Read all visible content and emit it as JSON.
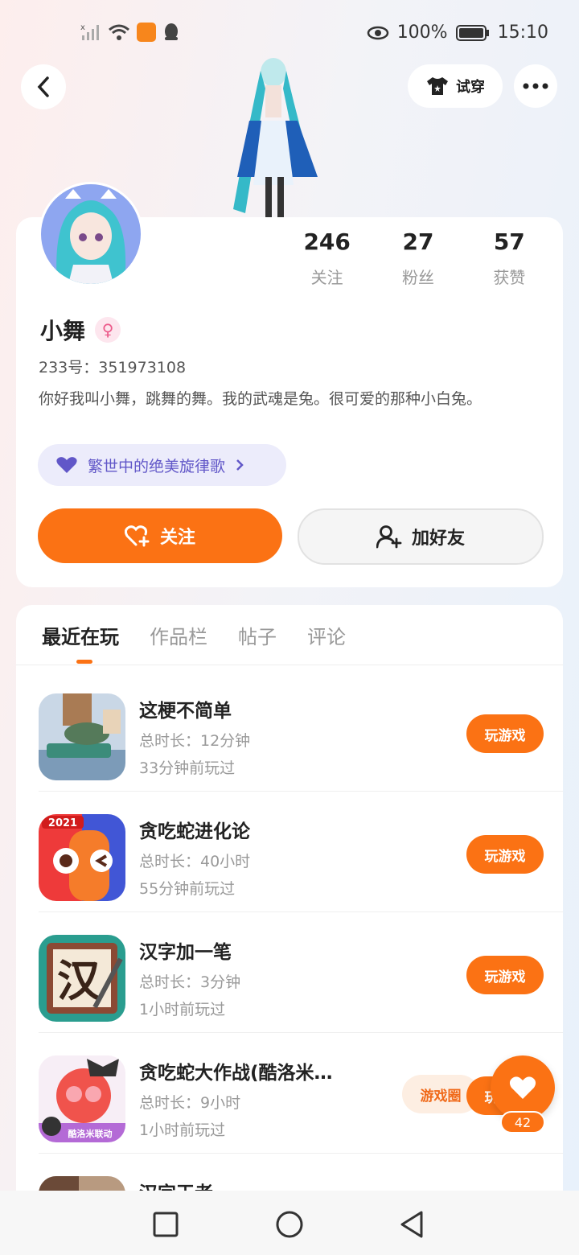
{
  "status_bar": {
    "battery": "100%",
    "time": "15:10",
    "icons": [
      "signal-icon",
      "wifi-icon",
      "app-notification-icon",
      "qq-icon",
      "eye-icon",
      "battery-icon"
    ]
  },
  "header": {
    "tryon_label": "试穿"
  },
  "profile": {
    "stats": [
      {
        "value": "246",
        "label": "关注"
      },
      {
        "value": "27",
        "label": "粉丝"
      },
      {
        "value": "57",
        "label": "获赞"
      }
    ],
    "name": "小舞",
    "gender_symbol": "♀",
    "id_line": "233号：351973108",
    "bio": "你好我叫小舞，跳舞的舞。我的武魂是兔。很可爱的那种小白兔。",
    "song": "繁世中的绝美旋律歌",
    "follow_label": "关注",
    "add_friend_label": "加好友"
  },
  "tabs": [
    "最近在玩",
    "作品栏",
    "帖子",
    "评论"
  ],
  "games": [
    {
      "title": "这梗不简单",
      "duration": "总时长：12分钟",
      "last_played": "33分钟前玩过",
      "play_label": "玩游戏"
    },
    {
      "title": "贪吃蛇进化论",
      "duration": "总时长：40小时",
      "last_played": "55分钟前玩过",
      "play_label": "玩游戏",
      "icon_badge": "2021"
    },
    {
      "title": "汉字加一笔",
      "duration": "总时长：3分钟",
      "last_played": "1小时前玩过",
      "play_label": "玩游戏",
      "icon_text": "汉"
    },
    {
      "title": "贪吃蛇大作战(酷洛米…",
      "duration": "总时长：9小时",
      "last_played": "1小时前玩过",
      "play_label": "玩游戏",
      "circle_label": "游戏圈",
      "icon_text": "酷洛米联动"
    },
    {
      "title": "汉字王者"
    }
  ],
  "like_count": "42",
  "colors": {
    "accent": "#fb7214",
    "song_pill_bg": "#ececfb",
    "song_pill_text": "#6157c8"
  }
}
